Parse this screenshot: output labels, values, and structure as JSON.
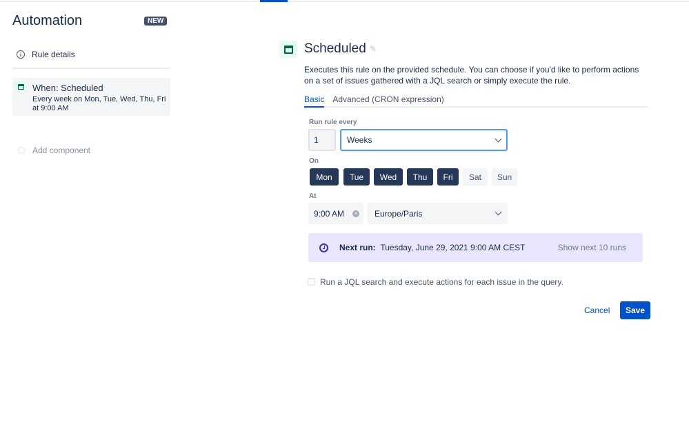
{
  "sidebar": {
    "title": "Automation",
    "badge": "NEW",
    "rule_details": "Rule details",
    "trigger": {
      "title": "When: Scheduled",
      "summary": "Every week on Mon, Tue, Wed, Thu, Fri at 9:00 AM"
    },
    "add_component": "Add component"
  },
  "main": {
    "title": "Scheduled",
    "description": "Executes this rule on the provided schedule. You can choose if you'd like to perform actions on a set of issues gathered with a JQL search or simply execute the rule.",
    "tabs": [
      {
        "label": "Basic",
        "active": true
      },
      {
        "label": "Advanced (CRON expression)",
        "active": false
      }
    ],
    "run_every_label": "Run rule every",
    "interval_value": "1",
    "interval_unit": "Weeks",
    "on_label": "On",
    "days": [
      {
        "label": "Mon",
        "selected": true
      },
      {
        "label": "Tue",
        "selected": true
      },
      {
        "label": "Wed",
        "selected": true
      },
      {
        "label": "Thu",
        "selected": true
      },
      {
        "label": "Fri",
        "selected": true
      },
      {
        "label": "Sat",
        "selected": false
      },
      {
        "label": "Sun",
        "selected": false
      }
    ],
    "at_label": "At",
    "time": "9:00 AM",
    "timezone": "Europe/Paris",
    "next_run_label": "Next run:",
    "next_run_value": "Tuesday, June 29, 2021 9:00 AM CEST",
    "show_next": "Show next 10 runs",
    "jql_checkbox": {
      "label": "Run a JQL search and execute actions for each issue in the query.",
      "checked": false
    },
    "cancel": "Cancel",
    "save": "Save"
  },
  "colors": {
    "accent": "#0052cc",
    "day_selected": "#253858",
    "next_run_bg": "#eae6ff"
  }
}
